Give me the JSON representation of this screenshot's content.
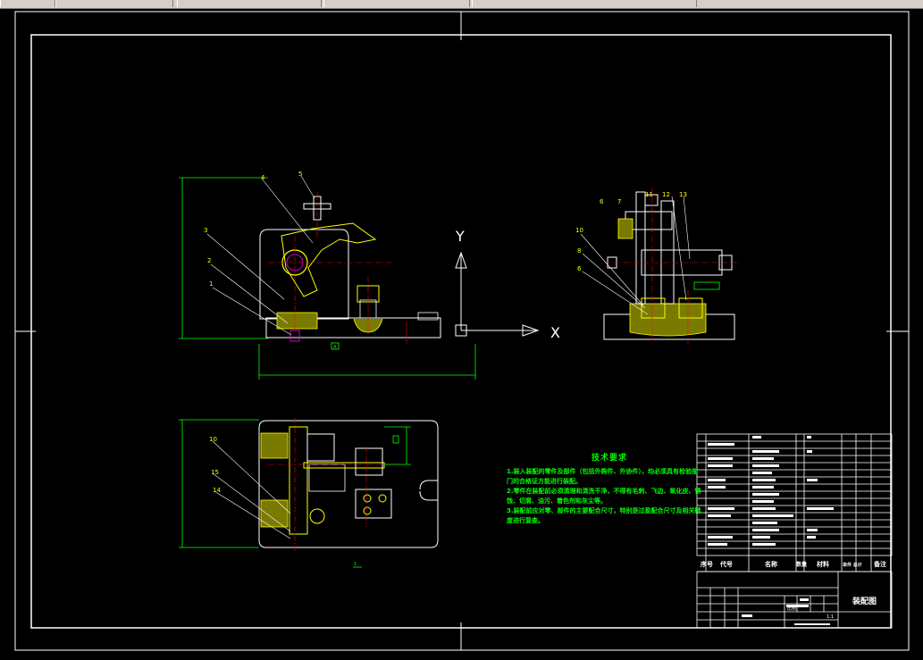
{
  "window": {
    "tabs": [
      {
        "label": ""
      },
      {
        "label": ""
      },
      {
        "label": ""
      },
      {
        "label": ""
      },
      {
        "label": ""
      }
    ]
  },
  "labels": {
    "axis_y": "Y",
    "axis_x": "X",
    "part_numbers_front": [
      "4",
      "5",
      "3",
      "2",
      "1"
    ],
    "part_numbers_side": [
      "6",
      "7",
      "11",
      "12",
      "13",
      "10",
      "8",
      "6"
    ],
    "part_numbers_top": [
      "10",
      "15",
      "14"
    ],
    "datum_a": "A",
    "section_1": "1"
  },
  "tech_requirements": {
    "title": "技术要求",
    "lines": [
      "1.装入装配的零件及部件（包括外购件、外协件），均必须具有检验部",
      "门的合格证方能进行装配。",
      "2.零件在装配前必须清理和清洗干净，不得有毛刺、飞边、氧化皮、锈",
      "蚀、切屑、油污、着色剂和灰尘等。",
      "3.装配前应对零、部件的主要配合尺寸，特别是过盈配合尺寸及相关精",
      "度进行复查。"
    ]
  },
  "title_block": {
    "header_cols": [
      "序号",
      "代号",
      "名称",
      "数量",
      "材料",
      "单件 总计",
      "备注"
    ],
    "drawing_name": "装配图",
    "scale_label": "比例",
    "ratio": "1:1"
  },
  "colors": {
    "frame": "#ffffff",
    "green": "#00ff00",
    "yellow": "#ffff00",
    "red": "#ff0000",
    "cyan": "#00ffff",
    "magenta": "#ff00ff"
  }
}
